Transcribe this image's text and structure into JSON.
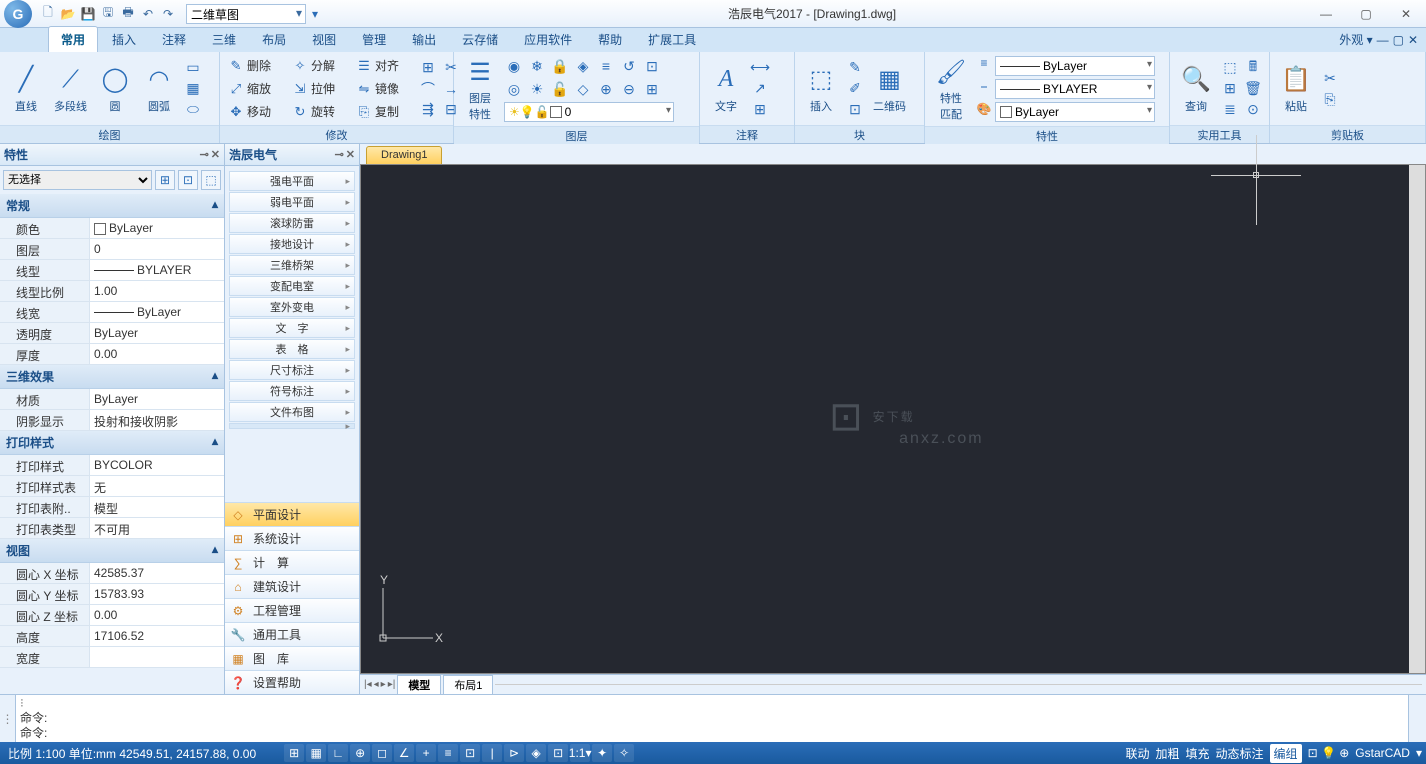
{
  "title": "浩辰电气2017 - [Drawing1.dwg]",
  "workspace": "二维草图",
  "ribbon_tabs": [
    "常用",
    "插入",
    "注释",
    "三维",
    "布局",
    "视图",
    "管理",
    "输出",
    "云存储",
    "应用软件",
    "帮助",
    "扩展工具"
  ],
  "ribbon_active": 0,
  "appearance_label": "外观",
  "panels": {
    "draw": {
      "title": "绘图",
      "btns": [
        "直线",
        "多段线",
        "圆",
        "圆弧"
      ]
    },
    "modify": {
      "title": "修改",
      "row1": [
        "删除",
        "分解",
        "对齐"
      ],
      "row2": [
        "缩放",
        "拉伸",
        "镜像"
      ],
      "row3": [
        "移动",
        "旋转",
        "复制"
      ]
    },
    "layer": {
      "title": "图层",
      "big": "图层\n特性",
      "current": "0"
    },
    "anno": {
      "title": "注释",
      "big": "文字"
    },
    "block": {
      "title": "块",
      "big": "插入",
      "qr": "二维码"
    },
    "props": {
      "title": "特性",
      "big": "特性\n匹配",
      "bylayer": "ByLayer",
      "bylayer_upper": "BYLAYER"
    },
    "utils": {
      "title": "实用工具",
      "big": "查询"
    },
    "clip": {
      "title": "剪贴板",
      "big": "粘贴"
    }
  },
  "properties": {
    "title": "特性",
    "selector": "无选择",
    "cats": {
      "general": {
        "label": "常规",
        "rows": [
          [
            "颜色",
            "ByLayer"
          ],
          [
            "图层",
            "0"
          ],
          [
            "线型",
            "BYLAYER"
          ],
          [
            "线型比例",
            "1.00"
          ],
          [
            "线宽",
            "ByLayer"
          ],
          [
            "透明度",
            "ByLayer"
          ],
          [
            "厚度",
            "0.00"
          ]
        ]
      },
      "threed": {
        "label": "三维效果",
        "rows": [
          [
            "材质",
            "ByLayer"
          ],
          [
            "阴影显示",
            "投射和接收阴影"
          ]
        ]
      },
      "plot": {
        "label": "打印样式",
        "rows": [
          [
            "打印样式",
            "BYCOLOR"
          ],
          [
            "打印样式表",
            "无"
          ],
          [
            "打印表附..",
            "模型"
          ],
          [
            "打印表类型",
            "不可用"
          ]
        ]
      },
      "view": {
        "label": "视图",
        "rows": [
          [
            "圆心 X 坐标",
            "42585.37"
          ],
          [
            "圆心 Y 坐标",
            "15783.93"
          ],
          [
            "圆心 Z 坐标",
            "0.00"
          ],
          [
            "高度",
            "17106.52"
          ],
          [
            "宽度",
            ""
          ]
        ]
      }
    }
  },
  "haochen": {
    "title": "浩辰电气",
    "items": [
      "强电平面",
      "弱电平面",
      "滚球防雷",
      "接地设计",
      "三维桥架",
      "变配电室",
      "室外变电",
      "文　字",
      "表　格",
      "尺寸标注",
      "符号标注",
      "文件布图"
    ],
    "cats": [
      "平面设计",
      "系统设计",
      "计　算",
      "建筑设计",
      "工程管理",
      "通用工具",
      "图　库",
      "设置帮助"
    ],
    "cat_active": 0
  },
  "doc_tab": "Drawing1",
  "model_tabs": [
    "模型",
    "布局1"
  ],
  "cmd": {
    "history": [
      "命令:"
    ],
    "prompt": "命令:"
  },
  "status": {
    "left": "比例 1:100  单位:mm  42549.51, 24157.88, 0.00",
    "right": [
      "联动",
      "加粗",
      "填充",
      "动态标注",
      "编组"
    ],
    "brand": "GstarCAD"
  },
  "watermark": {
    "main": "安下载",
    "sub": "anxz.com"
  }
}
